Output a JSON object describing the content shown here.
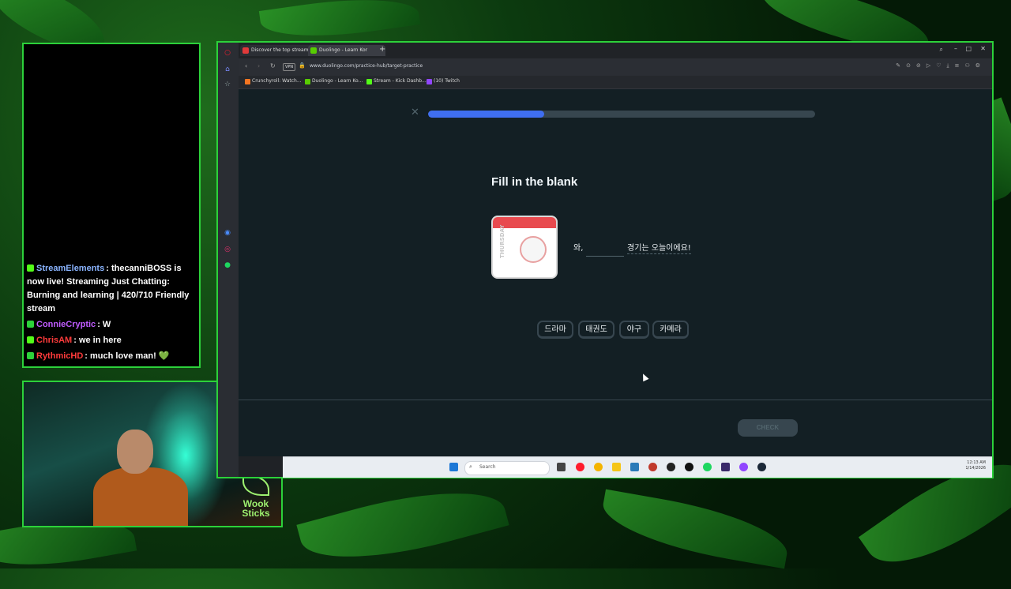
{
  "chat": {
    "messages": [
      {
        "user": "StreamElements",
        "user_color": "#8ab4ff",
        "text": ": thecanniBOSS is now live! Streaming Just Chatting: Burning and learning | 420/710 Friendly stream"
      },
      {
        "user": "ConnieCryptic",
        "user_color": "#c05cff",
        "text": ": W"
      },
      {
        "user": "ChrisAM",
        "user_color": "#ff3b3b",
        "text": ": we in here"
      },
      {
        "user": "RythmicHD",
        "user_color": "#ff3b3b",
        "text": ": much love man! 💚"
      }
    ]
  },
  "webcam": {
    "logo_line1": "Wook",
    "logo_line2": "Sticks"
  },
  "browser": {
    "tabs": [
      {
        "label": "Discover the top streams",
        "favicon_color": "#e03a3a"
      },
      {
        "label": "Duolingo - Learn Kor",
        "favicon_color": "#58cc02"
      }
    ],
    "url": "www.duolingo.com/practice-hub/target-practice",
    "vpn_label": "VPN",
    "bookmarks": [
      {
        "label": "Crunchyroll: Watch...",
        "favicon_color": "#f47521"
      },
      {
        "label": "Duolingo - Learn Ko...",
        "favicon_color": "#58cc02"
      },
      {
        "label": "Stream - Kick Dashb...",
        "favicon_color": "#53fc18"
      },
      {
        "label": "(10) Twitch",
        "favicon_color": "#9146ff"
      }
    ]
  },
  "lesson": {
    "progress_fraction": 0.3,
    "heading": "Fill in the blank",
    "calendar_day": "THURSDAY",
    "sentence_start": "와,",
    "sentence_end": "경기는 오늘이에요!",
    "word_bank": [
      "드라마",
      "태권도",
      "야구",
      "카메라"
    ],
    "check_label": "CHECK"
  },
  "taskbar": {
    "search_placeholder": "Search",
    "time": "12:13 AM",
    "date": "1/14/2026"
  }
}
